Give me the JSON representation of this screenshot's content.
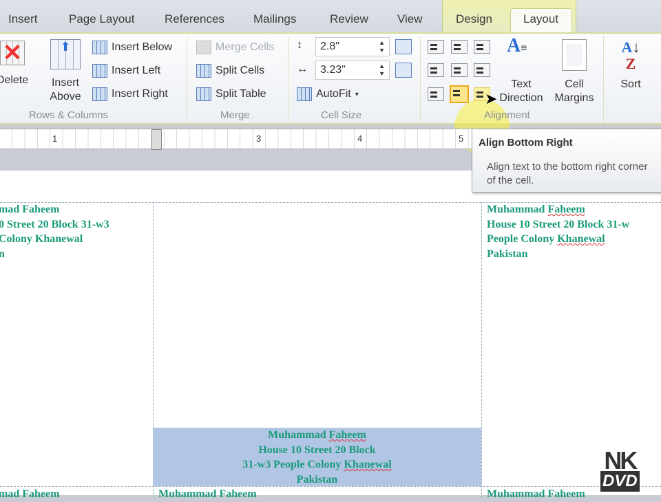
{
  "tabs": [
    "Insert",
    "Page Layout",
    "References",
    "Mailings",
    "Review",
    "View",
    "Design",
    "Layout"
  ],
  "active_tab": "Layout",
  "rows_columns": {
    "delete": "Delete",
    "insert_above": "Insert Above",
    "insert_below": "Insert Below",
    "insert_left": "Insert Left",
    "insert_right": "Insert Right",
    "label": "Rows & Columns"
  },
  "merge": {
    "merge_cells": "Merge Cells",
    "split_cells": "Split Cells",
    "split_table": "Split Table",
    "label": "Merge"
  },
  "cell_size": {
    "height": "2.8\"",
    "width": "3.23\"",
    "autofit": "AutoFit",
    "label": "Cell Size"
  },
  "alignment": {
    "text_direction": "Text Direction",
    "cell_margins": "Cell Margins",
    "label": "Alignment"
  },
  "data": {
    "sort": "Sort"
  },
  "ruler": [
    "1",
    "3",
    "4",
    "5"
  ],
  "tooltip": {
    "title": "Align Bottom Right",
    "body": "Align text to the bottom right corner of the cell."
  },
  "address": {
    "name1": "Muhammad ",
    "name2": "Faheem",
    "line2": "House 10 Street 20 Block",
    "line2b": "31-w3",
    "line3a": "People Colony ",
    "line3b": "Khanewal",
    "country": "Pakistan"
  },
  "left_cell": {
    "l1": "mad Faheem",
    "l2": "0 Street 20 Block 31-w3",
    "l3": "Colony Khanewal",
    "l4": "n"
  },
  "right_cell": {
    "l2": "House 10 Street 20 Block 31-w"
  },
  "bottom_row": {
    "left": "mad Faheem",
    "mid": "Muhammad Faheem",
    "right": "Muhammad Faheem"
  },
  "logo": {
    "top": "NK",
    "bottom": "DVD"
  }
}
